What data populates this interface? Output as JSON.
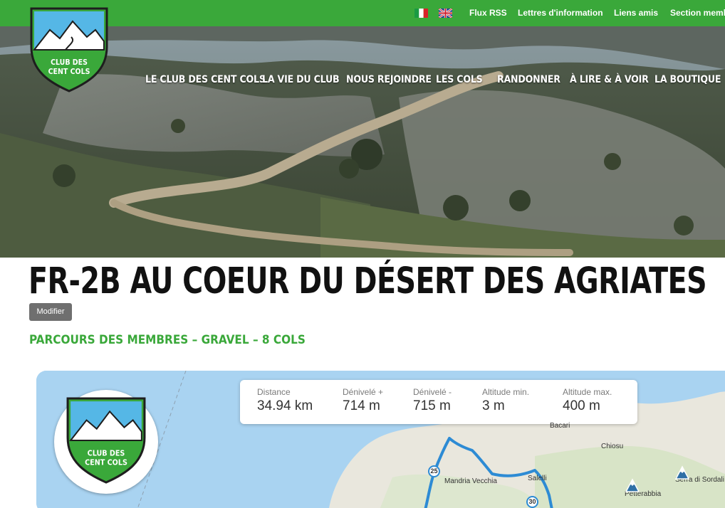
{
  "topbar": {
    "flags": [
      "Italiano",
      "English"
    ],
    "links": [
      "Flux RSS",
      "Lettres d'information",
      "Liens amis",
      "Section memb"
    ]
  },
  "logo": {
    "line1": "CLUB DES",
    "line2": "CENT COLS"
  },
  "nav": {
    "items": [
      "LE CLUB DES CENT COLS",
      "LA VIE DU CLUB",
      "NOUS REJOINDRE",
      "LES COLS",
      "RANDONNER",
      "À LIRE & À VOIR",
      "LA BOUTIQUE"
    ]
  },
  "page": {
    "title": "FR-2B AU COEUR DU DÉSERT DES AGRIATES",
    "edit_label": "Modifier",
    "subtitle": "PARCOURS DES MEMBRES – GRAVEL – 8 COLS"
  },
  "map": {
    "logo_line1": "CLUB DES",
    "logo_line2": "CENT COLS",
    "stats": [
      {
        "label": "Distance",
        "value": "34.94 km"
      },
      {
        "label": "Dénivelé +",
        "value": "714 m"
      },
      {
        "label": "Dénivelé -",
        "value": "715 m"
      },
      {
        "label": "Altitude min.",
        "value": "3 m"
      },
      {
        "label": "Altitude max.",
        "value": "400 m"
      }
    ],
    "places": [
      "Mandria Vecchia",
      "Chiosu",
      "Salelli",
      "Bacari",
      "Petterabbia",
      "Serra di Sordali"
    ],
    "markers": [
      "25",
      "30"
    ],
    "colors": {
      "route": "#2d8bd4",
      "brand_green": "#3aa83a"
    }
  }
}
